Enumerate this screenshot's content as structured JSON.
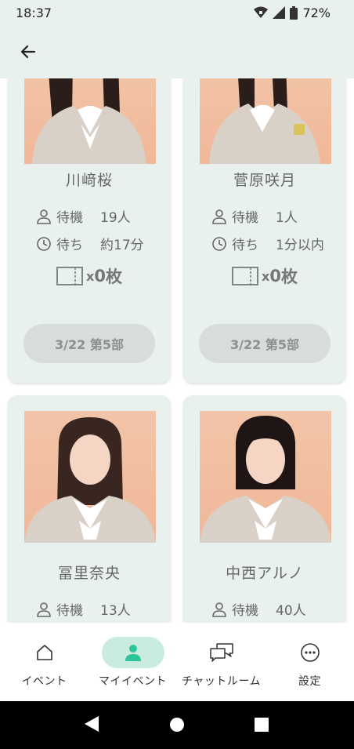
{
  "status_bar": {
    "time": "18:37",
    "battery": "72%"
  },
  "app_bar": {
    "back_icon": "arrow-left-icon"
  },
  "cards": [
    {
      "name": "川﨑桜",
      "wait_label": "待機",
      "wait_value": "19人",
      "time_label": "待ち",
      "time_value": "約17分",
      "ticket_x": "x",
      "ticket_count": "0",
      "ticket_unit": "枚",
      "slot": "3/22 第5部"
    },
    {
      "name": "菅原咲月",
      "wait_label": "待機",
      "wait_value": "1人",
      "time_label": "待ち",
      "time_value": "1分以内",
      "ticket_x": "x",
      "ticket_count": "0",
      "ticket_unit": "枚",
      "slot": "3/22 第5部"
    },
    {
      "name": "冨里奈央",
      "wait_label": "待機",
      "wait_value": "13人"
    },
    {
      "name": "中西アルノ",
      "wait_label": "待機",
      "wait_value": "40人"
    }
  ],
  "bottom_nav": [
    {
      "label": "イベント",
      "icon": "home-icon"
    },
    {
      "label": "マイイベント",
      "icon": "person-icon",
      "active": true
    },
    {
      "label": "チャットルーム",
      "icon": "chat-icon"
    },
    {
      "label": "設定",
      "icon": "more-icon"
    }
  ],
  "colors": {
    "card_bg": "#e8f1ee",
    "accent": "#2cc49a",
    "accent_bg": "#c9ecdf",
    "photo_bg": "#f2c4a8"
  }
}
